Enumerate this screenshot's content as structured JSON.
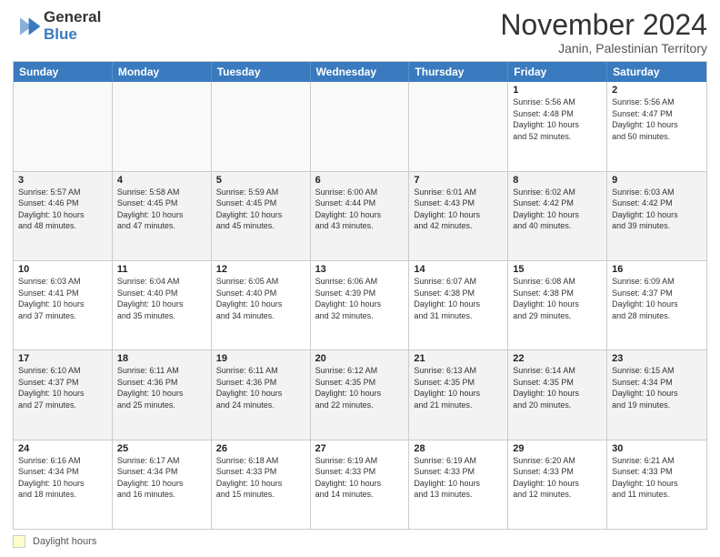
{
  "logo": {
    "general": "General",
    "blue": "Blue"
  },
  "title": "November 2024",
  "subtitle": "Janin, Palestinian Territory",
  "days_of_week": [
    "Sunday",
    "Monday",
    "Tuesday",
    "Wednesday",
    "Thursday",
    "Friday",
    "Saturday"
  ],
  "legend_label": "Daylight hours",
  "weeks": [
    [
      {
        "day": "",
        "info": "",
        "empty": true
      },
      {
        "day": "",
        "info": "",
        "empty": true
      },
      {
        "day": "",
        "info": "",
        "empty": true
      },
      {
        "day": "",
        "info": "",
        "empty": true
      },
      {
        "day": "",
        "info": "",
        "empty": true
      },
      {
        "day": "1",
        "info": "Sunrise: 5:56 AM\nSunset: 4:48 PM\nDaylight: 10 hours\nand 52 minutes.",
        "empty": false
      },
      {
        "day": "2",
        "info": "Sunrise: 5:56 AM\nSunset: 4:47 PM\nDaylight: 10 hours\nand 50 minutes.",
        "empty": false
      }
    ],
    [
      {
        "day": "3",
        "info": "Sunrise: 5:57 AM\nSunset: 4:46 PM\nDaylight: 10 hours\nand 48 minutes.",
        "empty": false
      },
      {
        "day": "4",
        "info": "Sunrise: 5:58 AM\nSunset: 4:45 PM\nDaylight: 10 hours\nand 47 minutes.",
        "empty": false
      },
      {
        "day": "5",
        "info": "Sunrise: 5:59 AM\nSunset: 4:45 PM\nDaylight: 10 hours\nand 45 minutes.",
        "empty": false
      },
      {
        "day": "6",
        "info": "Sunrise: 6:00 AM\nSunset: 4:44 PM\nDaylight: 10 hours\nand 43 minutes.",
        "empty": false
      },
      {
        "day": "7",
        "info": "Sunrise: 6:01 AM\nSunset: 4:43 PM\nDaylight: 10 hours\nand 42 minutes.",
        "empty": false
      },
      {
        "day": "8",
        "info": "Sunrise: 6:02 AM\nSunset: 4:42 PM\nDaylight: 10 hours\nand 40 minutes.",
        "empty": false
      },
      {
        "day": "9",
        "info": "Sunrise: 6:03 AM\nSunset: 4:42 PM\nDaylight: 10 hours\nand 39 minutes.",
        "empty": false
      }
    ],
    [
      {
        "day": "10",
        "info": "Sunrise: 6:03 AM\nSunset: 4:41 PM\nDaylight: 10 hours\nand 37 minutes.",
        "empty": false
      },
      {
        "day": "11",
        "info": "Sunrise: 6:04 AM\nSunset: 4:40 PM\nDaylight: 10 hours\nand 35 minutes.",
        "empty": false
      },
      {
        "day": "12",
        "info": "Sunrise: 6:05 AM\nSunset: 4:40 PM\nDaylight: 10 hours\nand 34 minutes.",
        "empty": false
      },
      {
        "day": "13",
        "info": "Sunrise: 6:06 AM\nSunset: 4:39 PM\nDaylight: 10 hours\nand 32 minutes.",
        "empty": false
      },
      {
        "day": "14",
        "info": "Sunrise: 6:07 AM\nSunset: 4:38 PM\nDaylight: 10 hours\nand 31 minutes.",
        "empty": false
      },
      {
        "day": "15",
        "info": "Sunrise: 6:08 AM\nSunset: 4:38 PM\nDaylight: 10 hours\nand 29 minutes.",
        "empty": false
      },
      {
        "day": "16",
        "info": "Sunrise: 6:09 AM\nSunset: 4:37 PM\nDaylight: 10 hours\nand 28 minutes.",
        "empty": false
      }
    ],
    [
      {
        "day": "17",
        "info": "Sunrise: 6:10 AM\nSunset: 4:37 PM\nDaylight: 10 hours\nand 27 minutes.",
        "empty": false
      },
      {
        "day": "18",
        "info": "Sunrise: 6:11 AM\nSunset: 4:36 PM\nDaylight: 10 hours\nand 25 minutes.",
        "empty": false
      },
      {
        "day": "19",
        "info": "Sunrise: 6:11 AM\nSunset: 4:36 PM\nDaylight: 10 hours\nand 24 minutes.",
        "empty": false
      },
      {
        "day": "20",
        "info": "Sunrise: 6:12 AM\nSunset: 4:35 PM\nDaylight: 10 hours\nand 22 minutes.",
        "empty": false
      },
      {
        "day": "21",
        "info": "Sunrise: 6:13 AM\nSunset: 4:35 PM\nDaylight: 10 hours\nand 21 minutes.",
        "empty": false
      },
      {
        "day": "22",
        "info": "Sunrise: 6:14 AM\nSunset: 4:35 PM\nDaylight: 10 hours\nand 20 minutes.",
        "empty": false
      },
      {
        "day": "23",
        "info": "Sunrise: 6:15 AM\nSunset: 4:34 PM\nDaylight: 10 hours\nand 19 minutes.",
        "empty": false
      }
    ],
    [
      {
        "day": "24",
        "info": "Sunrise: 6:16 AM\nSunset: 4:34 PM\nDaylight: 10 hours\nand 18 minutes.",
        "empty": false
      },
      {
        "day": "25",
        "info": "Sunrise: 6:17 AM\nSunset: 4:34 PM\nDaylight: 10 hours\nand 16 minutes.",
        "empty": false
      },
      {
        "day": "26",
        "info": "Sunrise: 6:18 AM\nSunset: 4:33 PM\nDaylight: 10 hours\nand 15 minutes.",
        "empty": false
      },
      {
        "day": "27",
        "info": "Sunrise: 6:19 AM\nSunset: 4:33 PM\nDaylight: 10 hours\nand 14 minutes.",
        "empty": false
      },
      {
        "day": "28",
        "info": "Sunrise: 6:19 AM\nSunset: 4:33 PM\nDaylight: 10 hours\nand 13 minutes.",
        "empty": false
      },
      {
        "day": "29",
        "info": "Sunrise: 6:20 AM\nSunset: 4:33 PM\nDaylight: 10 hours\nand 12 minutes.",
        "empty": false
      },
      {
        "day": "30",
        "info": "Sunrise: 6:21 AM\nSunset: 4:33 PM\nDaylight: 10 hours\nand 11 minutes.",
        "empty": false
      }
    ]
  ]
}
